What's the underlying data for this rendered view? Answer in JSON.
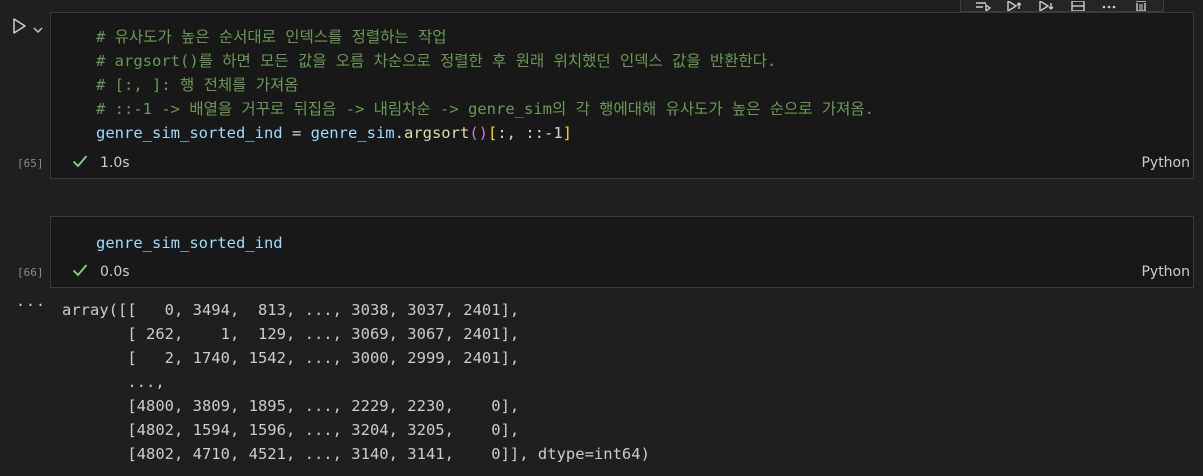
{
  "cells": [
    {
      "exec_count": "[65]",
      "status_time": "1.0s",
      "language": "Python",
      "comment_lines": [
        "# 유사도가 높은 순서대로 인덱스를 정렬하는 작업",
        "# argsort()를 하면 모든 값을 오름 차순으로 정렬한 후 원래 위치했던 인덱스 값을 반환한다.",
        "# [:, ]: 행 전체를 가져옴",
        "# ::-1 -> 배열을 거꾸로 뒤집음 -> 내림차순 -> genre_sim의 각 행에대해 유사도가 높은 순으로 가져옴."
      ],
      "code_var": "genre_sim_sorted_ind",
      "code_eq": " = ",
      "code_obj": "genre_sim",
      "code_dot": ".",
      "code_fn": "argsort",
      "code_paren": "()",
      "code_bracket_open": "[",
      "code_slice": ":, ::-1",
      "code_bracket_close": "]"
    },
    {
      "exec_count": "[66]",
      "status_time": "0.0s",
      "language": "Python",
      "code_var": "genre_sim_sorted_ind"
    }
  ],
  "output": {
    "dots": "···",
    "lines": [
      "array([[   0, 3494,  813, ..., 3038, 3037, 2401],",
      "       [ 262,    1,  129, ..., 3069, 3067, 2401],",
      "       [   2, 1740, 1542, ..., 3000, 2999, 2401],",
      "       ...,",
      "       [4800, 3809, 1895, ..., 2229, 2230,    0],",
      "       [4802, 1594, 1596, ..., 3204, 3205,    0],",
      "       [4802, 4710, 4521, ..., 3140, 3141,    0]], dtype=int64)"
    ]
  },
  "colors": {
    "comment": "#6a9955",
    "variable": "#9cdcfe",
    "function": "#dcdcaa",
    "success_check": "#89d185"
  },
  "icons": [
    "run-by-line-icon",
    "execute-above-icon",
    "execute-below-icon",
    "split-cell-icon",
    "more-icon",
    "delete-icon",
    "run-cell-icon",
    "chevron-down-icon",
    "check-icon"
  ]
}
